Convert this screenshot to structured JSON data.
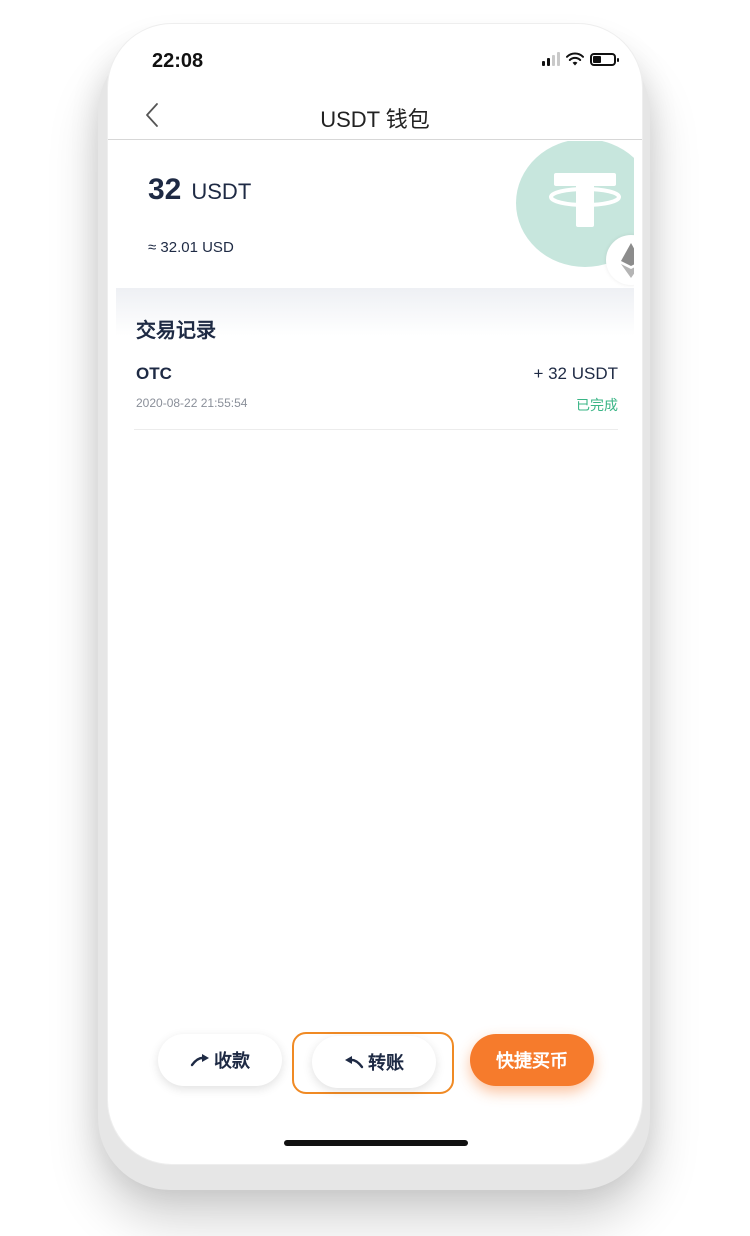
{
  "status_bar": {
    "time": "22:08"
  },
  "nav": {
    "title": "USDT 钱包"
  },
  "balance": {
    "amount": "32",
    "unit": "USDT",
    "usd_value": "≈ 32.01 USD"
  },
  "colors": {
    "accent": "#f67b2c",
    "success": "#3ab586",
    "coin_bg": "#c7e6dd",
    "text_dark": "#1e2a44",
    "highlight_border": "#f08a24"
  },
  "records": {
    "title": "交易记录",
    "items": [
      {
        "type": "OTC",
        "time": "2020-08-22 21:55:54",
        "amount": "+ 32 USDT",
        "status": "已完成"
      }
    ]
  },
  "actions": {
    "receive_label": "收款",
    "transfer_label": "转账",
    "buy_label": "快捷买币"
  },
  "icons": {
    "back": "chevron-left-icon",
    "coin": "tether-logo-icon",
    "network": "ethereum-icon",
    "receive": "arrow-icon",
    "transfer": "arrow-icon"
  }
}
